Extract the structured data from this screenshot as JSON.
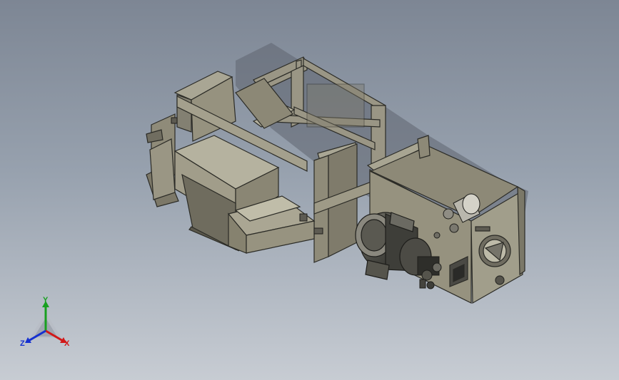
{
  "viewport": {
    "background_top": "#7d8694",
    "background_bottom": "#c7ccd3",
    "model_color": "#8f8b7a"
  },
  "triad": {
    "x_label": "X",
    "y_label": "Y",
    "z_label": "Z",
    "x_color": "#d21818",
    "y_color": "#18a020",
    "z_color": "#1530d0"
  }
}
